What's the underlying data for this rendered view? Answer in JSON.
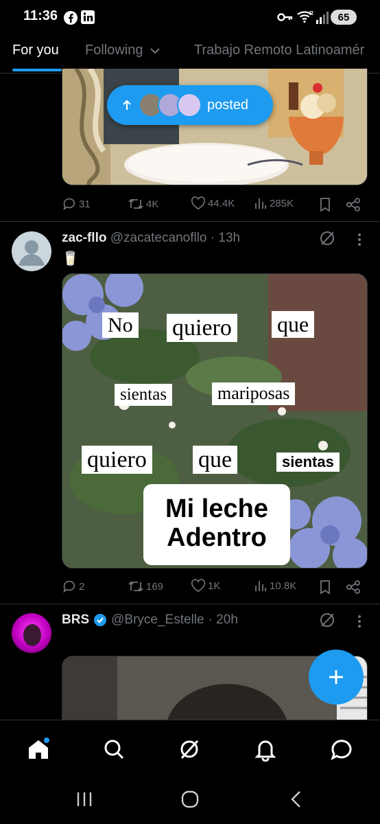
{
  "status_bar": {
    "time": "11:36",
    "battery": "65"
  },
  "tabs": [
    {
      "label": "For you"
    },
    {
      "label": "Following"
    },
    {
      "label": "Trabajo Remoto Latinoamér"
    }
  ],
  "posted_pill": {
    "label": "posted"
  },
  "post1": {
    "stats": {
      "replies": "31",
      "reposts": "4K",
      "likes": "44.4K",
      "views": "285K"
    }
  },
  "post2": {
    "name": "zac-fllo",
    "handle": "@zacatecanofllo",
    "time": "· 13h",
    "text": "🥛",
    "meme": {
      "w1": "No",
      "w2": "quiero",
      "w3": "que",
      "w4": "sientas",
      "w5": "mariposas",
      "w6": "quiero",
      "w7": "que",
      "w8": "sientas",
      "w9": "Mi leche",
      "w10": "Adentro"
    },
    "stats": {
      "replies": "2",
      "reposts": "169",
      "likes": "1K",
      "views": "10.8K"
    }
  },
  "post3": {
    "name": "BRS",
    "handle": "@Bryce_Estelle",
    "time": "· 20h",
    "verified": true
  },
  "colors": {
    "accent": "#1d9bf0",
    "background": "#000000",
    "muted": "#71767b"
  },
  "bottom_nav": [
    "home-icon",
    "search-icon",
    "grok-icon",
    "notifications-icon",
    "messages-icon"
  ]
}
